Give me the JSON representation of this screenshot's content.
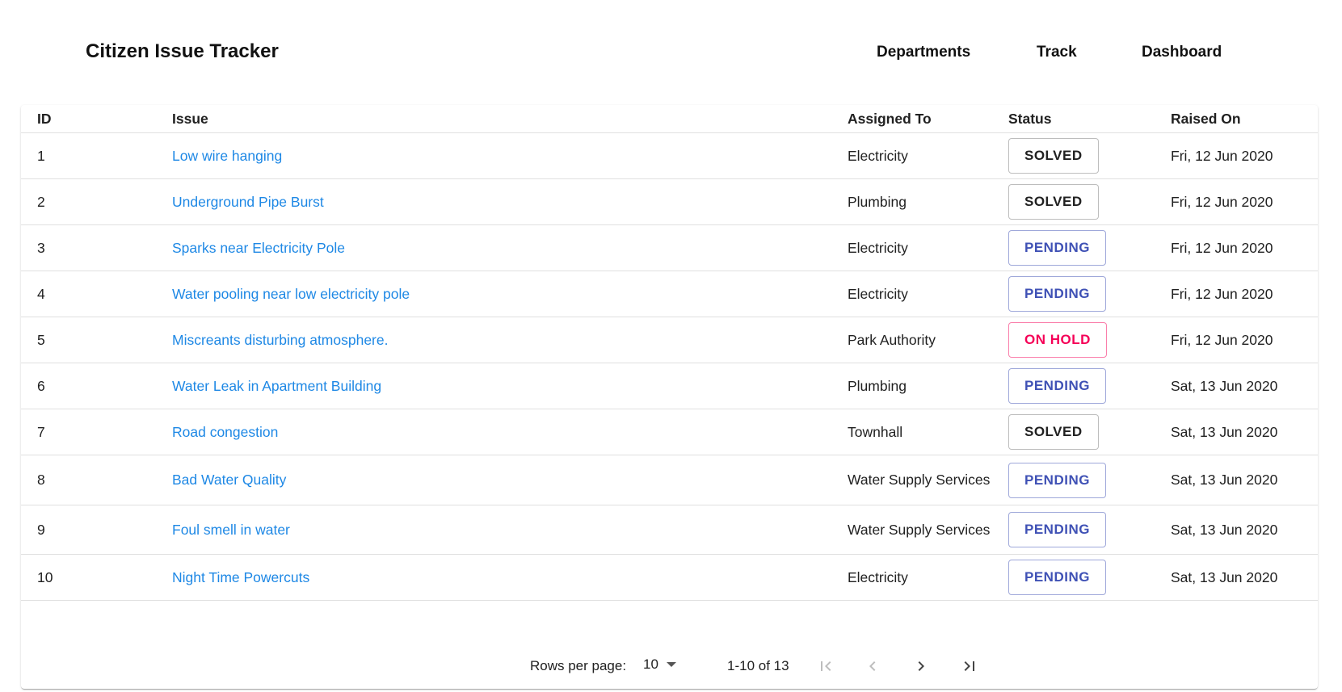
{
  "header": {
    "title": "Citizen Issue Tracker",
    "nav": [
      "Departments",
      "Track",
      "Dashboard"
    ]
  },
  "table": {
    "columns": [
      "ID",
      "Issue",
      "Assigned To",
      "Status",
      "Raised On"
    ],
    "rows": [
      {
        "id": "1",
        "issue": "Low wire hanging",
        "assigned": "Electricity",
        "status": "SOLVED",
        "status_kind": "solved",
        "date": "Fri, 12 Jun 2020"
      },
      {
        "id": "2",
        "issue": "Underground Pipe Burst",
        "assigned": "Plumbing",
        "status": "SOLVED",
        "status_kind": "solved",
        "date": "Fri, 12 Jun 2020"
      },
      {
        "id": "3",
        "issue": "Sparks near Electricity Pole",
        "assigned": "Electricity",
        "status": "PENDING",
        "status_kind": "pending",
        "date": "Fri, 12 Jun 2020"
      },
      {
        "id": "4",
        "issue": "Water pooling near low electricity pole",
        "assigned": "Electricity",
        "status": "PENDING",
        "status_kind": "pending",
        "date": "Fri, 12 Jun 2020"
      },
      {
        "id": "5",
        "issue": "Miscreants disturbing atmosphere.",
        "assigned": "Park Authority",
        "status": "ON HOLD",
        "status_kind": "onhold",
        "date": "Fri, 12 Jun 2020"
      },
      {
        "id": "6",
        "issue": "Water Leak in Apartment Building",
        "assigned": "Plumbing",
        "status": "PENDING",
        "status_kind": "pending",
        "date": "Sat, 13 Jun 2020"
      },
      {
        "id": "7",
        "issue": "Road congestion",
        "assigned": "Townhall",
        "status": "SOLVED",
        "status_kind": "solved",
        "date": "Sat, 13 Jun 2020"
      },
      {
        "id": "8",
        "issue": "Bad Water Quality",
        "assigned": "Water Supply Services",
        "status": "PENDING",
        "status_kind": "pending",
        "date": "Sat, 13 Jun 2020"
      },
      {
        "id": "9",
        "issue": "Foul smell in water",
        "assigned": "Water Supply Services",
        "status": "PENDING",
        "status_kind": "pending",
        "date": "Sat, 13 Jun 2020"
      },
      {
        "id": "10",
        "issue": "Night Time Powercuts",
        "assigned": "Electricity",
        "status": "PENDING",
        "status_kind": "pending",
        "date": "Sat, 13 Jun 2020"
      }
    ]
  },
  "pagination": {
    "rows_per_page_label": "Rows per page:",
    "rows_per_page": "10",
    "range": "1-10 of 13",
    "icons": [
      "first-page-icon",
      "previous-page-icon",
      "next-page-icon",
      "last-page-icon"
    ]
  },
  "colors": {
    "link": "#1e88e5",
    "pending": "#3f51b5",
    "onhold": "#f50057",
    "solved": "#212121"
  }
}
